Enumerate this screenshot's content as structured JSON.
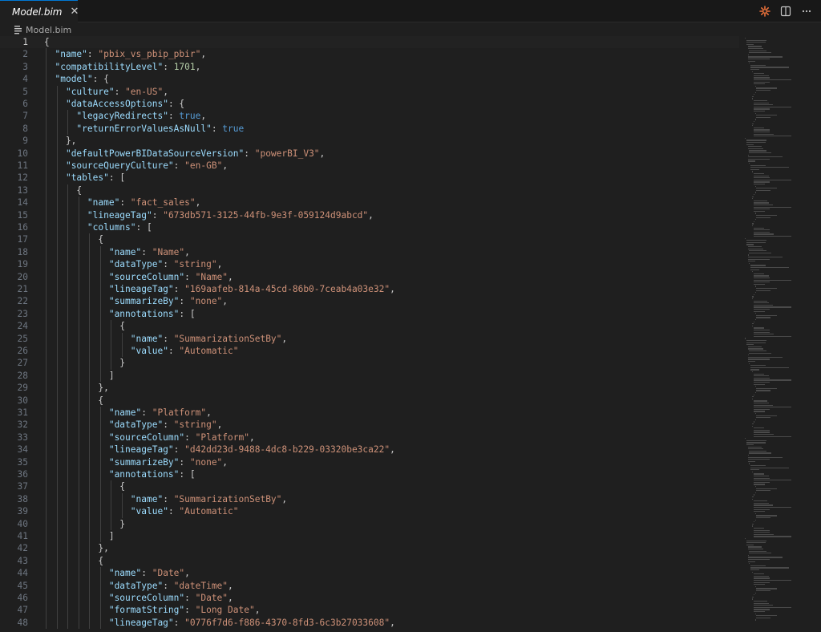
{
  "tab": {
    "label": "Model.bim",
    "close": "✕",
    "file_icon": "file-lines-icon"
  },
  "breadcrumb": {
    "label": "Model.bim",
    "file_icon": "file-lines-icon"
  },
  "actions": [
    "copilot-sparkle-icon",
    "split-editor-icon",
    "more-actions-icon"
  ],
  "colors": {
    "key": "#9cdcfe",
    "string": "#ce9178",
    "number": "#b5cea8",
    "bool": "#569cd6",
    "punct": "#cccccc"
  },
  "editor": {
    "current_line": 1,
    "lines": [
      "{",
      "  \"name\": \"pbix_vs_pbip_pbir\",",
      "  \"compatibilityLevel\": 1701,",
      "  \"model\": {",
      "    \"culture\": \"en-US\",",
      "    \"dataAccessOptions\": {",
      "      \"legacyRedirects\": true,",
      "      \"returnErrorValuesAsNull\": true",
      "    },",
      "    \"defaultPowerBIDataSourceVersion\": \"powerBI_V3\",",
      "    \"sourceQueryCulture\": \"en-GB\",",
      "    \"tables\": [",
      "      {",
      "        \"name\": \"fact_sales\",",
      "        \"lineageTag\": \"673db571-3125-44fb-9e3f-059124d9abcd\",",
      "        \"columns\": [",
      "          {",
      "            \"name\": \"Name\",",
      "            \"dataType\": \"string\",",
      "            \"sourceColumn\": \"Name\",",
      "            \"lineageTag\": \"169aafeb-814a-45cd-86b0-7ceab4a03e32\",",
      "            \"summarizeBy\": \"none\",",
      "            \"annotations\": [",
      "              {",
      "                \"name\": \"SummarizationSetBy\",",
      "                \"value\": \"Automatic\"",
      "              }",
      "            ]",
      "          },",
      "          {",
      "            \"name\": \"Platform\",",
      "            \"dataType\": \"string\",",
      "            \"sourceColumn\": \"Platform\",",
      "            \"lineageTag\": \"d42dd23d-9488-4dc8-b229-03320be3ca22\",",
      "            \"summarizeBy\": \"none\",",
      "            \"annotations\": [",
      "              {",
      "                \"name\": \"SummarizationSetBy\",",
      "                \"value\": \"Automatic\"",
      "              }",
      "            ]",
      "          },",
      "          {",
      "            \"name\": \"Date\",",
      "            \"dataType\": \"dateTime\",",
      "            \"sourceColumn\": \"Date\",",
      "            \"formatString\": \"Long Date\",",
      "            \"lineageTag\": \"0776f7d6-f886-4370-8fd3-6c3b27033608\","
    ]
  }
}
